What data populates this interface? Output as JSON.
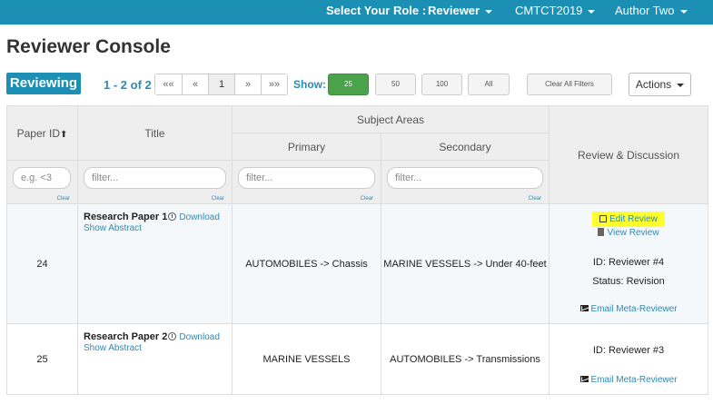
{
  "nav": {
    "role_label": "Select Your Role :",
    "role_value": "Reviewer",
    "conference": "CMTCT2019",
    "user": "Author Two"
  },
  "page_title": "Reviewer Console",
  "toolbar": {
    "reviewing_label": "Reviewing",
    "range_text": "1 - 2 of 2",
    "pager": [
      "««",
      "«",
      "1",
      "»",
      "»»"
    ],
    "pager_active": "1",
    "show_label": "Show:",
    "show_options": [
      "25",
      "50",
      "100",
      "All"
    ],
    "show_selected": "25",
    "clear_filters": "Clear All Filters",
    "actions_label": "Actions"
  },
  "table": {
    "headers": {
      "paper_id": "Paper ID",
      "title": "Title",
      "subject_areas": "Subject Areas",
      "primary": "Primary",
      "secondary": "Secondary",
      "review": "Review & Discussion"
    },
    "filters": {
      "paper_id_placeholder": "e.g. <3",
      "title_placeholder": "filter...",
      "primary_placeholder": "filter...",
      "secondary_placeholder": "filter...",
      "clear_label": "Clear"
    },
    "rows": [
      {
        "paper_id": "24",
        "title": "Research Paper 1",
        "download": "Download",
        "show_abstract": "Show Abstract",
        "primary": "AUTOMOBILES -> Chassis",
        "secondary": "MARINE VESSELS -> Under 40-feet",
        "edit_review": "Edit Review",
        "view_review": "View Review",
        "reviewer_id": "ID: Reviewer #4",
        "status": "Status: Revision",
        "email": "Email Meta-Reviewer"
      },
      {
        "paper_id": "25",
        "title": "Research Paper 2",
        "download": "Download",
        "show_abstract": "Show Abstract",
        "primary": "MARINE VESSELS",
        "secondary": "AUTOMOBILES -> Transmissions",
        "reviewer_id": "ID: Reviewer #3",
        "email": "Email Meta-Reviewer"
      }
    ]
  },
  "colors": {
    "brand": "#1b8fb4",
    "link": "#2a8bb5",
    "active_show": "#4aa34a",
    "highlight": "#ffff2e"
  }
}
